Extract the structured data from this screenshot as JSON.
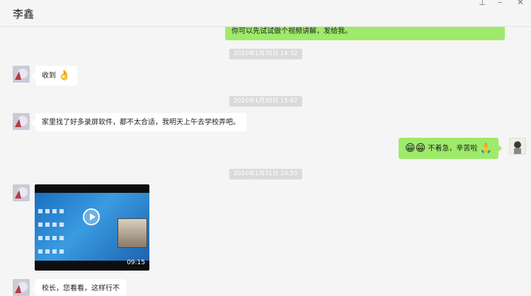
{
  "window": {
    "title": "李鑫",
    "pin_glyph": "⊥",
    "minimize_glyph": "–",
    "close_glyph": "✕"
  },
  "messages": {
    "m1": {
      "text": "你可以先试试做个视频讲解，发给我。"
    },
    "t1": "2020年1月30日 14:32",
    "m2": {
      "text": "收到",
      "emoji": "👌"
    },
    "t2": "2020年1月30日 15:47",
    "m3": {
      "text": "家里找了好多录屏软件，都不太合适，我明天上午去学校弄吧。"
    },
    "m4": {
      "emoji": "😁😁",
      "text": "不着急，辛苦啦",
      "emoji2": "🙏"
    },
    "t3": "2020年1月31日 10:50",
    "m5": {
      "duration": "09:15"
    },
    "m6": {
      "text": "校长，您看看，这样行不"
    }
  },
  "colors": {
    "self_bubble": "#9eea6a",
    "other_bubble": "#ffffff",
    "background": "#f5f5f5"
  }
}
